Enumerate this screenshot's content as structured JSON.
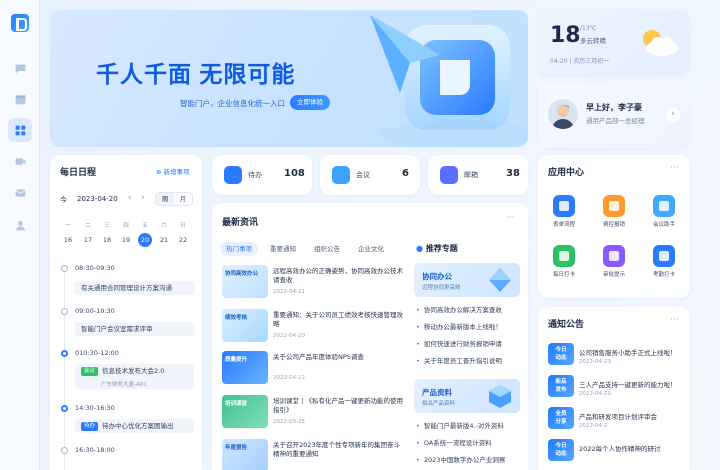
{
  "banner": {
    "title": "千人千面 无限可能",
    "subtitle": "智能门户，企业信息化统一入口",
    "cta": "立即体验"
  },
  "weather": {
    "temp": "18",
    "range": "/13℃",
    "condition": "多云转晴",
    "date": "04-20 | 农历三月初一"
  },
  "greeting": {
    "hello": "早上好，李子豪",
    "role": "通用产品部一总经理"
  },
  "schedule": {
    "title": "每日日程",
    "add_label": "新增事项",
    "today_label": "今",
    "current_date": "2023-04-20",
    "prev": "‹",
    "next": "›",
    "view_week": "周",
    "view_month": "月",
    "weekdays": [
      "一",
      "二",
      "三",
      "四",
      "五",
      "六",
      "日"
    ],
    "days": [
      "16",
      "17",
      "18",
      "19",
      "20",
      "21",
      "22"
    ],
    "selected_day_index": 4,
    "events": [
      {
        "time": "08:30-09:30",
        "title": "有关通用合同管理设计方案沟通",
        "tag": "",
        "sub": ""
      },
      {
        "time": "09:00-10:30",
        "title": "智能门户会议室需求评审",
        "tag": "",
        "sub": ""
      },
      {
        "time": "010:30-12:00",
        "title": "信息技术发布大会2.0",
        "tag": "会议",
        "sub": "广东财务大厦-A01"
      },
      {
        "time": "14:30-16:30",
        "title": "待办中心优化方案图输出",
        "tag": "待办",
        "sub": ""
      },
      {
        "time": "16:30-18:00",
        "title": "",
        "tag": "",
        "sub": ""
      }
    ]
  },
  "stats": [
    {
      "label": "待办",
      "value": "108",
      "color": "#2a7bff"
    },
    {
      "label": "会议",
      "value": "6",
      "color": "#3da2ff"
    },
    {
      "label": "邮箱",
      "value": "38",
      "color": "#5a6fff"
    }
  ],
  "news": {
    "title": "最新资讯",
    "more": "···",
    "tabs": [
      "热门事项",
      "重要通知",
      "组织公告",
      "企业文化"
    ],
    "active_tab": 0,
    "items": [
      {
        "title": "远程高效办公的正确姿势，协同高效办公技术请查收",
        "date": "2022-04-21",
        "thumb": "协同高效办公"
      },
      {
        "title": "重要通知：关于公司员工绩效考核快速管理攻略",
        "date": "2022-04-20",
        "thumb": "绩效考核"
      },
      {
        "title": "关于公司产品年度体验NPS调查",
        "date": "2022-04-22",
        "thumb": "质量提升"
      },
      {
        "title": "培训课堂丨《私有化产品一键更新功能的使用指引》",
        "date": "2022-03-25",
        "thumb": "培训课堂"
      },
      {
        "title": "关于召开2023年度个性专项新年的集团奋斗精神的重要通知",
        "date": "",
        "thumb": "年度报告"
      }
    ],
    "topics_title": "推荐专题",
    "topic_cards": [
      {
        "title": "协同办公",
        "sub": "远程协同更高效"
      },
      {
        "title": "产品资料",
        "sub": "相关产品资料"
      }
    ],
    "topic_items_a": [
      "协同高效办公解决方案查收",
      "移动办公最新版本上线啦！",
      "如何快速进行财务报销申请",
      "关于年度员工晋升指引说明"
    ],
    "topic_items_b": [
      "智能门户最新版4.-对外资料",
      "OA系统一流程设计资料",
      "2023中国数字办公产业洞察"
    ]
  },
  "apps": {
    "title": "应用中心",
    "more": "···",
    "items": [
      {
        "label": "表单流程",
        "color": "#2a7bff"
      },
      {
        "label": "费控报销",
        "color": "#ff9b2a"
      },
      {
        "label": "会议助手",
        "color": "#3fa8ff"
      },
      {
        "label": "每日打卡",
        "color": "#2fc066"
      },
      {
        "label": "审批提示",
        "color": "#8a5cff"
      },
      {
        "label": "考勤打卡",
        "color": "#2a7bff"
      }
    ]
  },
  "notices": {
    "title": "通知公告",
    "more": "···",
    "items": [
      {
        "badge": "今日\n动态",
        "title": "公司销售服务小助手正式上线啦！",
        "date": "2022-04-23"
      },
      {
        "badge": "新品\n发布",
        "title": "三人产品支持一键更新的能力啦！",
        "date": "2022-04-10"
      },
      {
        "badge": "全员\n分享",
        "title": "产品和研发项目计划评审会",
        "date": "2022-04-2"
      },
      {
        "badge": "今日\n动态",
        "title": "2022每个人协作精神的研讨",
        "date": ""
      }
    ]
  },
  "nav_icons": [
    "message-icon",
    "calendar-icon",
    "grid-icon",
    "video-icon",
    "mail-icon",
    "user-icon"
  ]
}
